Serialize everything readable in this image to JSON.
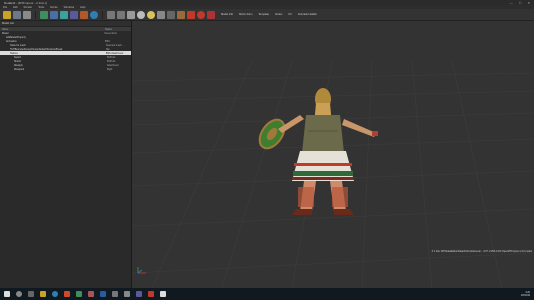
{
  "window": {
    "title": "RealEdit - [MTFmpoor - 2.11m.t]",
    "controls": [
      "—",
      "☐",
      "✕"
    ]
  },
  "menu": [
    "File",
    "Edit",
    "Render",
    "Tools",
    "Extras",
    "Windows",
    "Help"
  ],
  "toolbar": {
    "icons": [
      "open-icon",
      "save-icon",
      "select-icon",
      "move-icon",
      "rotate-icon",
      "scale-icon",
      "snap-icon",
      "grid-icon",
      "globe-icon",
      "undo-icon",
      "redo-icon",
      "view-icon",
      "eye-icon",
      "bulb-icon",
      "camera-icon",
      "cube-icon",
      "arrow-icon",
      "stop-icon",
      "record-icon",
      "settings-icon"
    ],
    "labels": [
      "Model Info",
      "Mirror Anim",
      "Template",
      "Vertex",
      "UV",
      "Animation Editor"
    ]
  },
  "panel": {
    "title": "Model List",
    "columns": [
      "Name",
      "Status"
    ],
    "rows": [
      {
        "name": "Model",
        "status": "Scene Root",
        "indent": 0,
        "selected": false
      },
      {
        "name": "AddModelProperty",
        "status": "",
        "indent": 1,
        "selected": false
      },
      {
        "name": "Animation",
        "status": "BSS",
        "indent": 1,
        "selected": false
      },
      {
        "name": "Node for mesh",
        "status": "Selected mesh ...",
        "indent": 2,
        "selected": false
      },
      {
        "name": "TMTBoundedGroupHumanDefaultTorsoAndHead",
        "status": "Skn",
        "indent": 2,
        "selected": false
      },
      {
        "name": "Helmet",
        "status": "BSS Attachment",
        "indent": 2,
        "selected": true
      },
      {
        "name": "Sword",
        "status": "SSPoint",
        "indent": 2,
        "selected": false
      },
      {
        "name": "Shield",
        "status": "SSPoint",
        "indent": 2,
        "selected": false
      },
      {
        "name": "Weapon",
        "status": "Attachment",
        "indent": 2,
        "selected": false
      },
      {
        "name": "Weapon2",
        "status": "Right",
        "indent": 2,
        "selected": false
      }
    ]
  },
  "viewport": {
    "status_text": "X 1 File: MTModelEditor\\Data\\Art\\Units\\Greek\\... 2/1? 1.05/6.1/0/0 OpenMTFmpoor 2.16.model",
    "accent_red": "#c0392b",
    "shield_green": "#3f7d2f",
    "bronze": "#a07a3a"
  },
  "taskbar": {
    "clock_time": "4:20",
    "clock_date": "1/5/2019"
  }
}
